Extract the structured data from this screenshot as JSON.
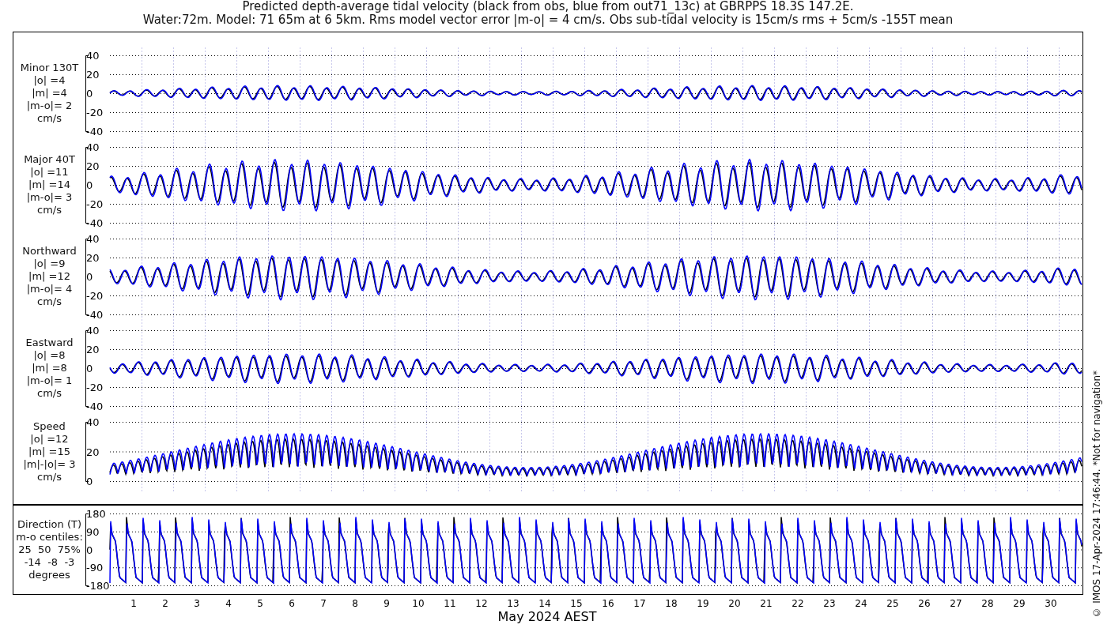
{
  "title_lines": [
    "Predicted depth-average tidal velocity (black from obs, blue from out71_13c) at GBRPPS 18.3S 147.2E.",
    "Water:72m. Model: 71 65m at 6 5km. Rms model vector error |m-o| = 4 cm/s. Obs sub-tidal velocity is 15cm/s rms + 5cm/s -155T mean"
  ],
  "panels": [
    {
      "kind": "velocity",
      "label_lines": [
        "Minor 130T",
        "|o| =4",
        "|m| =4",
        "|m-o|= 2",
        "cm/s"
      ],
      "yticks": [
        "40",
        "20",
        "0",
        "-20",
        "-40"
      ]
    },
    {
      "kind": "velocity",
      "label_lines": [
        "Major 40T",
        "|o| =11",
        "|m| =14",
        "|m-o|= 3",
        "cm/s"
      ],
      "yticks": [
        "40",
        "20",
        "0",
        "-20",
        "-40"
      ]
    },
    {
      "kind": "velocity",
      "label_lines": [
        "Northward",
        "|o| =9",
        "|m| =12",
        "|m-o|= 4",
        "cm/s"
      ],
      "yticks": [
        "40",
        "20",
        "0",
        "-20",
        "-40"
      ]
    },
    {
      "kind": "velocity",
      "label_lines": [
        "Eastward",
        "|o| =8",
        "|m| =8",
        "|m-o|= 1",
        "cm/s"
      ],
      "yticks": [
        "40",
        "20",
        "0",
        "-20",
        "-40"
      ]
    },
    {
      "kind": "speed",
      "label_lines": [
        "Speed",
        "|o| =12",
        "|m| =15",
        "|m|-|o|= 3",
        "cm/s"
      ],
      "yticks": [
        "40",
        "20",
        "0"
      ]
    },
    {
      "kind": "direction",
      "label_lines": [
        "Direction (T)",
        "m-o centiles:",
        "25  50  75%",
        "-14  -8  -3",
        "degrees"
      ],
      "yticks": [
        "180",
        "90",
        "0",
        "-90",
        "-180"
      ]
    }
  ],
  "x_axis": {
    "day_labels": [
      "1",
      "2",
      "3",
      "4",
      "5",
      "6",
      "7",
      "8",
      "9",
      "10",
      "11",
      "12",
      "13",
      "14",
      "15",
      "16",
      "17",
      "18",
      "19",
      "20",
      "21",
      "22",
      "23",
      "24",
      "25",
      "26",
      "27",
      "28",
      "29",
      "30"
    ],
    "label": "May 2024 AEST"
  },
  "credit": "© IMOS 17-Apr-2024 17:46:44. *Not for navigation*"
}
